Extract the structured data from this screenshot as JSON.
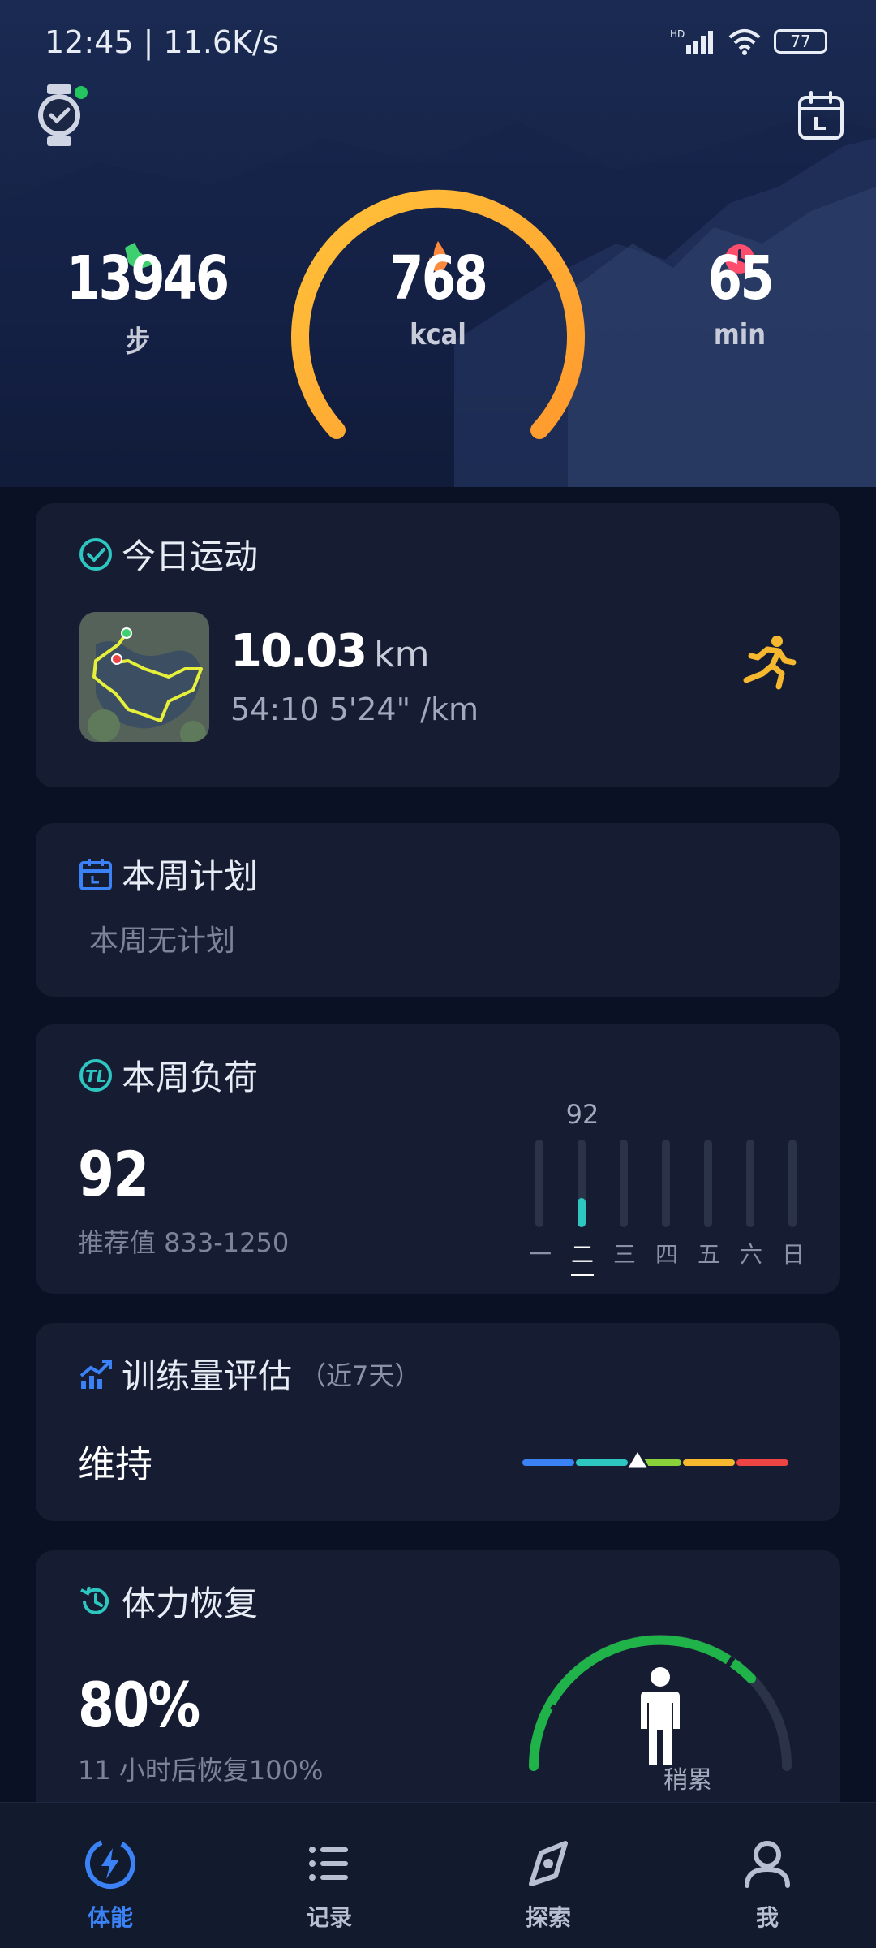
{
  "status_bar": {
    "time_text": "12:45 | 11.6K/s",
    "network_label": "HD",
    "battery_level": "77"
  },
  "header": {
    "watch_icon": "watch-icon",
    "calendar_icon": "calendar-icon"
  },
  "summary": {
    "steps": {
      "value": "13946",
      "unit": "步",
      "icon": "shoe-icon",
      "color": "#3ecf6e"
    },
    "calories": {
      "value": "768",
      "unit": "kcal",
      "icon": "flame-icon",
      "color": "#ff8a3d"
    },
    "minutes": {
      "value": "65",
      "unit": "min",
      "icon": "clock-icon",
      "color": "#ff4d6d"
    },
    "gauge_colors": [
      "#ffc23a",
      "#ff9a2e"
    ]
  },
  "today_activity": {
    "title": "今日运动",
    "distance": "10.03",
    "distance_unit": "km",
    "duration": "54:10",
    "pace": "5'24\" /km",
    "activity_icon": "running-icon"
  },
  "weekly_plan": {
    "title": "本周计划",
    "empty_text": "本周无计划"
  },
  "weekly_load": {
    "title": "本周负荷",
    "value": "92",
    "recommended_label": "推荐值 833-1250",
    "bar_value_label": "92",
    "days": [
      {
        "label": "一",
        "value": 0
      },
      {
        "label": "二",
        "value": 92
      },
      {
        "label": "三",
        "value": 0
      },
      {
        "label": "四",
        "value": 0
      },
      {
        "label": "五",
        "value": 0
      },
      {
        "label": "六",
        "value": 0
      },
      {
        "label": "日",
        "value": 0
      }
    ],
    "active_day_index": 1
  },
  "training_assessment": {
    "title": "训练量评估",
    "period": "（近7天）",
    "status": "维持",
    "scale_colors": [
      "#3b82f6",
      "#2ec6c0",
      "#8bd13a",
      "#f5b82e",
      "#ef4444"
    ]
  },
  "recovery": {
    "title": "体力恢复",
    "percent": "80%",
    "recovery_text": "11 小时后恢复100%",
    "state_label": "稍累",
    "arc_color": "#1fb34a"
  },
  "bottom_nav": {
    "items": [
      {
        "label": "体能",
        "icon": "lightning-icon",
        "active": true
      },
      {
        "label": "记录",
        "icon": "list-icon",
        "active": false
      },
      {
        "label": "探索",
        "icon": "compass-icon",
        "active": false
      },
      {
        "label": "我",
        "icon": "user-icon",
        "active": false
      }
    ]
  }
}
